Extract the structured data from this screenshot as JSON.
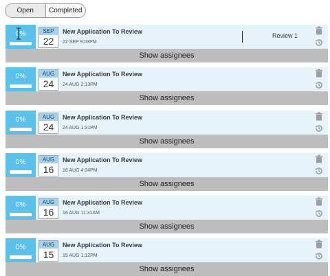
{
  "tabs": {
    "open": "Open",
    "completed": "Completed"
  },
  "colors": {
    "progress": "#5bc0ea",
    "card_bg": "#e6f3fb",
    "footer_bg": "#bdbdbd"
  },
  "cards": [
    {
      "progress": "0%",
      "progress_value": 0,
      "month": "SEP",
      "day": "22",
      "title": "New Application To Review",
      "timestamp": "22 SEP 9:03PM",
      "assignee_label": "Review 1",
      "show_assignees": "Show assignees"
    },
    {
      "progress": "0%",
      "progress_value": 0,
      "month": "AUG",
      "day": "24",
      "title": "New Application To Review",
      "timestamp": "24 AUG 2:13PM",
      "show_assignees": "Show assignees"
    },
    {
      "progress": "0%",
      "progress_value": 0,
      "month": "AUG",
      "day": "24",
      "title": "New Application To Review",
      "timestamp": "24 AUG 1:31PM",
      "show_assignees": "Show assignees"
    },
    {
      "progress": "0%",
      "progress_value": 0,
      "month": "AUG",
      "day": "16",
      "title": "New Application To Review",
      "timestamp": "16 AUG 4:34PM",
      "show_assignees": "Show assignees"
    },
    {
      "progress": "0%",
      "progress_value": 0,
      "month": "AUG",
      "day": "16",
      "title": "New Application To Review",
      "timestamp": "16 AUG 11:31AM",
      "show_assignees": "Show assignees"
    },
    {
      "progress": "0%",
      "progress_value": 0,
      "month": "AUG",
      "day": "15",
      "title": "New Application To Review",
      "timestamp": "15 AUG 1:12PM",
      "show_assignees": "Show assignees"
    }
  ]
}
